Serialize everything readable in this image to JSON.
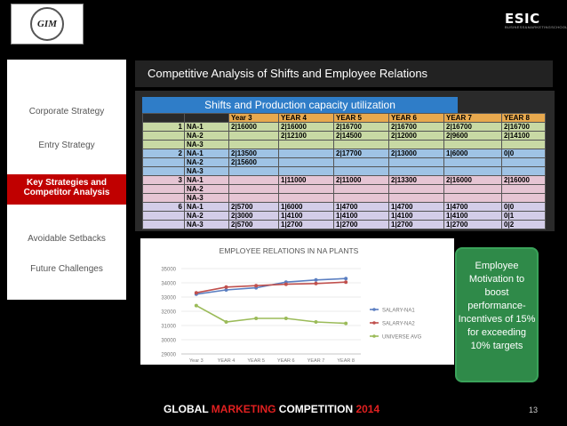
{
  "header": {
    "logo_left_text": "GIM",
    "logo_right_brand": "ESIC",
    "logo_right_sub": "BUSINESS&MARKETINGSCHOOL"
  },
  "sidebar": {
    "items": [
      {
        "label": "Corporate Strategy"
      },
      {
        "label": "Entry Strategy"
      },
      {
        "label": "Key Strategies  and Competitor Analysis"
      },
      {
        "label": "Avoidable Setbacks"
      },
      {
        "label": "Future Challenges"
      }
    ]
  },
  "main": {
    "title": "Competitive Analysis of Shifts and Employee Relations",
    "shifts_title": "Shifts and Production capacity utilization",
    "table": {
      "headers": [
        "",
        "",
        "Year 3",
        "YEAR 4",
        "YEAR 5",
        "YEAR 6",
        "YEAR 7",
        "YEAR 8"
      ],
      "rows": [
        {
          "group": "1",
          "plant": "NA-1",
          "cells": [
            "2|16000",
            "2|16000",
            "2|16700",
            "2|16700",
            "2|16700",
            "2|16700"
          ],
          "color": "green"
        },
        {
          "group": "",
          "plant": "NA-2",
          "cells": [
            "",
            "2|12100",
            "2|14500",
            "2|12000",
            "2|9600",
            "2|14100"
          ],
          "color": "green"
        },
        {
          "group": "",
          "plant": "NA-3",
          "cells": [
            "",
            "",
            "",
            "",
            "",
            ""
          ],
          "color": "green"
        },
        {
          "group": "2",
          "plant": "NA-1",
          "cells": [
            "2|13500",
            "",
            "2|17700",
            "2|13000",
            "1|6000",
            "0|0"
          ],
          "color": "blue"
        },
        {
          "group": "",
          "plant": "NA-2",
          "cells": [
            "2|15600",
            "",
            "",
            "",
            "",
            ""
          ],
          "color": "blue"
        },
        {
          "group": "",
          "plant": "NA-3",
          "cells": [
            "",
            "",
            "",
            "",
            "",
            ""
          ],
          "color": "blue"
        },
        {
          "group": "3",
          "plant": "NA-1",
          "cells": [
            "",
            "1|11000",
            "2|11000",
            "2|13300",
            "2|16000",
            "2|16000"
          ],
          "color": "pink"
        },
        {
          "group": "",
          "plant": "NA-2",
          "cells": [
            "",
            "",
            "",
            "",
            "",
            ""
          ],
          "color": "pink"
        },
        {
          "group": "",
          "plant": "NA-3",
          "cells": [
            "",
            "",
            "",
            "",
            "",
            ""
          ],
          "color": "pink"
        },
        {
          "group": "6",
          "plant": "NA-1",
          "cells": [
            "2|5700",
            "1|6000",
            "1|4700",
            "1|4700",
            "1|4700",
            "0|0"
          ],
          "color": "lav"
        },
        {
          "group": "",
          "plant": "NA-2",
          "cells": [
            "2|3000",
            "1|4100",
            "1|4100",
            "1|4100",
            "1|4100",
            "0|1"
          ],
          "color": "lav"
        },
        {
          "group": "",
          "plant": "NA-3",
          "cells": [
            "2|5700",
            "1|2700",
            "1|2700",
            "1|2700",
            "1|2700",
            "0|2"
          ],
          "color": "lav"
        }
      ]
    },
    "motivation_text": "Employee Motivation to boost performance- Incentives of 15% for exceeding 10% targets"
  },
  "chart_data": {
    "type": "line",
    "title": "EMPLOYEE RELATIONS IN NA PLANTS",
    "categories": [
      "Year 3",
      "YEAR 4",
      "YEAR 5",
      "YEAR 6",
      "YEAR 7",
      "YEAR 8"
    ],
    "yticks": [
      "35000",
      "34000",
      "33000",
      "32000",
      "31000",
      "30000",
      "29000"
    ],
    "ylim": [
      29000,
      35000
    ],
    "legend_position": "right",
    "series": [
      {
        "name": "SALARY-NA1",
        "color": "#5b7fc1",
        "values": [
          33200,
          33500,
          33650,
          34050,
          34200,
          34300
        ]
      },
      {
        "name": "SALARY-NA2",
        "color": "#c0504d",
        "values": [
          33300,
          33700,
          33800,
          33900,
          33950,
          34050
        ]
      },
      {
        "name": "UNIVERSE AVG",
        "color": "#9bbb59",
        "values": [
          32400,
          31250,
          31500,
          31500,
          31250,
          31150
        ]
      }
    ]
  },
  "footer": {
    "part1": "GLOBAL ",
    "part2": "MARKETING",
    "part3": " COMPETITION ",
    "part4": "2014",
    "page": "13"
  },
  "colors": {
    "accent_red": "#c00000",
    "title_blue": "#2f7dc8",
    "motivation_green": "#2f8a49"
  }
}
